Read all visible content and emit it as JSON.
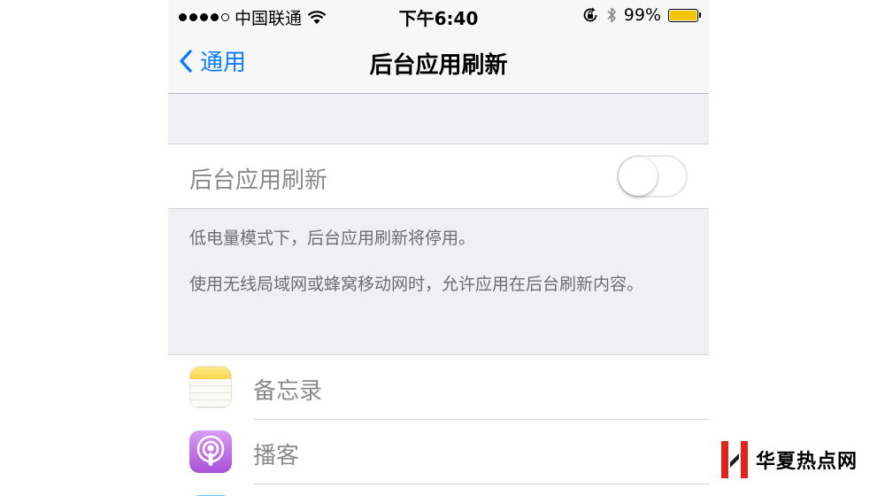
{
  "status_bar": {
    "carrier": "中国联通",
    "time": "下午6:40",
    "battery_percent": "99%",
    "battery_level": 0.99,
    "battery_color": "#f5c400",
    "icons": [
      "signal-dots-icon",
      "wifi-icon",
      "orientation-lock-icon",
      "bluetooth-icon",
      "battery-icon"
    ]
  },
  "nav": {
    "back_label": "通用",
    "title": "后台应用刷新",
    "accent_color": "#0b7cff"
  },
  "toggle": {
    "label": "后台应用刷新",
    "state": "off"
  },
  "footer": {
    "note_1": "低电量模式下，后台应用刷新将停用。",
    "note_2": "使用无线局域网或蜂窝移动网时，允许应用在后台刷新内容。"
  },
  "apps": [
    {
      "name": "备忘录",
      "icon": "notes-icon"
    },
    {
      "name": "播客",
      "icon": "podcasts-icon"
    }
  ],
  "watermark": {
    "text": "华夏热点网"
  }
}
